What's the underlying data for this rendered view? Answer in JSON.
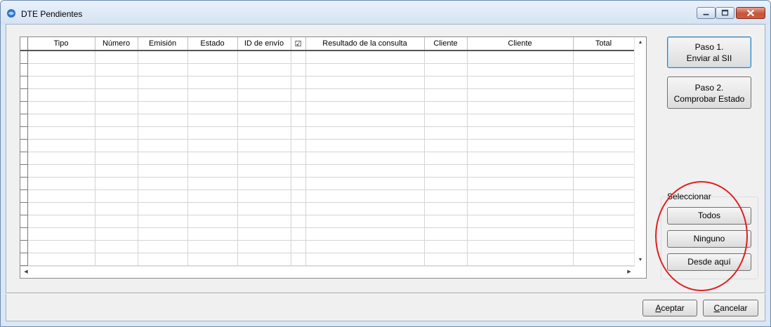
{
  "window": {
    "title": "DTE Pendientes",
    "app_icon": "app-logo-icon"
  },
  "grid": {
    "columns": [
      "Tipo",
      "Número",
      "Emisión",
      "Estado",
      "ID de envío",
      "☑",
      "Resultado de la consulta",
      "Cliente",
      "Cliente",
      "Total"
    ],
    "row_count": 17
  },
  "actions": {
    "paso1_line1": "Paso 1.",
    "paso1_line2": "Enviar al SII",
    "paso2_line1": "Paso 2.",
    "paso2_line2": "Comprobar Estado"
  },
  "select": {
    "label": "Seleccionar",
    "todos": "Todos",
    "ninguno": "Ninguno",
    "desde": "Desde aquí"
  },
  "footer": {
    "accept_first": "A",
    "accept_rest": "ceptar",
    "cancel_first": "C",
    "cancel_rest": "ancelar"
  },
  "colors": {
    "annotation": "#e02020",
    "titlebar": "#dae7f5"
  }
}
